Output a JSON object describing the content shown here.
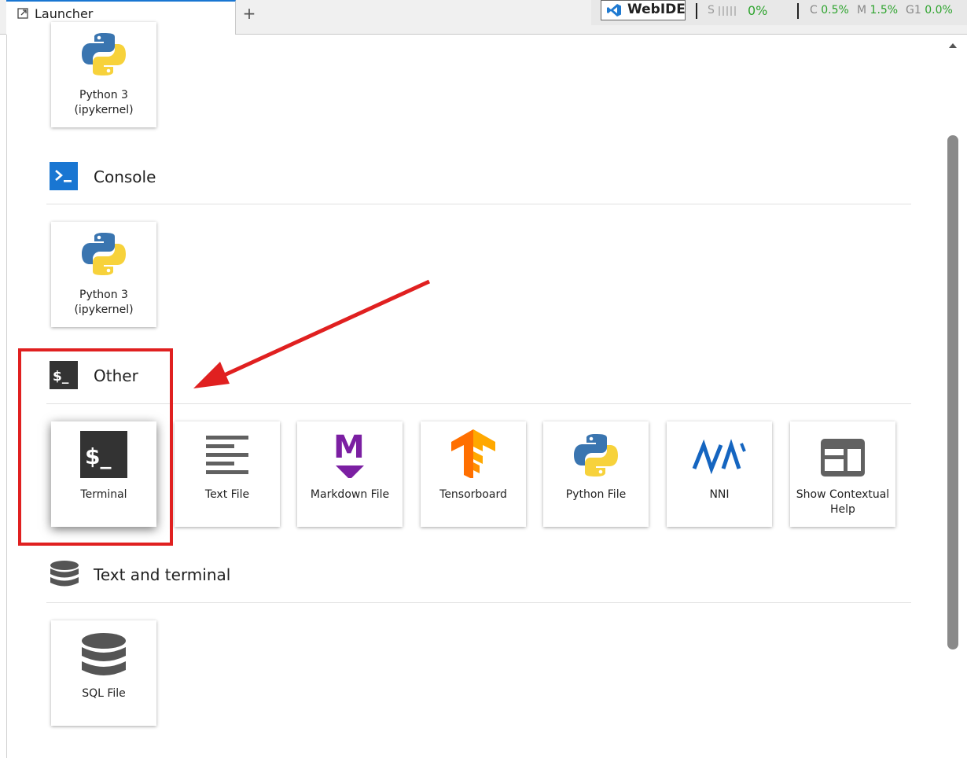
{
  "tabs": {
    "active_label": "Launcher",
    "add_label": "+"
  },
  "status_bar": {
    "webide_label": "WebIDE",
    "s_label": "S",
    "s_value": "0%",
    "c_label": "C",
    "c_value": "0.5%",
    "m_label": "M",
    "m_value": "1.5%",
    "g1_label": "G1",
    "g1_value": "0.0%"
  },
  "notebook_section": {
    "cards": [
      {
        "label": "Python 3\n(ipykernel)",
        "icon": "python-icon"
      }
    ]
  },
  "console_section": {
    "title": "Console",
    "icon": "console-icon",
    "cards": [
      {
        "label": "Python 3\n(ipykernel)",
        "icon": "python-icon"
      }
    ]
  },
  "other_section": {
    "title": "Other",
    "icon": "terminal-icon",
    "cards": [
      {
        "label": "Terminal",
        "icon": "terminal-icon"
      },
      {
        "label": "Text File",
        "icon": "text-file-icon"
      },
      {
        "label": "Markdown File",
        "icon": "markdown-icon"
      },
      {
        "label": "Tensorboard",
        "icon": "tensorflow-icon"
      },
      {
        "label": "Python File",
        "icon": "python-icon"
      },
      {
        "label": "NNI",
        "icon": "nni-icon"
      },
      {
        "label": "Show Contextual Help",
        "icon": "contextual-help-icon"
      }
    ]
  },
  "text_terminal_section": {
    "title": "Text and terminal",
    "icon": "database-icon",
    "cards": [
      {
        "label": "SQL File",
        "icon": "database-icon"
      }
    ]
  },
  "colors": {
    "accent": "#1976d2",
    "annotation": "#e02020",
    "status_green": "#2ea42e",
    "terminal_bg": "#333333",
    "markdown_purple": "#7b1fa2"
  }
}
